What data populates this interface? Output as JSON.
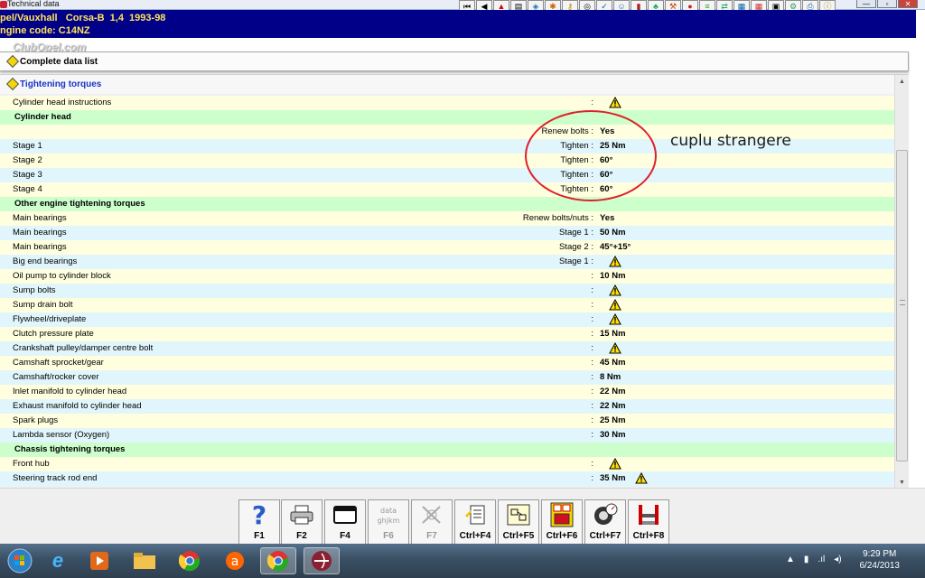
{
  "window": {
    "title": "Technical data"
  },
  "vehicle": {
    "line1": "pel/Vauxhall   Corsa-B  1,4  1993-98",
    "line2": "ngine code: C14NZ"
  },
  "watermark": "ClubOpel.com",
  "nav": {
    "complete_data_label": "Complete data list",
    "section_label": "Tightening torques"
  },
  "rows": [
    {
      "name": "Cylinder head instructions",
      "qualifier": ":",
      "value": "",
      "warn": true,
      "bg": "y"
    },
    {
      "name": "Cylinder head",
      "header": true
    },
    {
      "name": "",
      "qualifier": "Renew bolts :",
      "value": "Yes",
      "bg": "y"
    },
    {
      "name": "Stage 1",
      "qualifier": "Tighten :",
      "value": "25 Nm",
      "bg": "b"
    },
    {
      "name": "Stage 2",
      "qualifier": "Tighten :",
      "value": "60°",
      "bg": "y"
    },
    {
      "name": "Stage 3",
      "qualifier": "Tighten :",
      "value": "60°",
      "bg": "b"
    },
    {
      "name": "Stage 4",
      "qualifier": "Tighten :",
      "value": "60°",
      "bg": "y"
    },
    {
      "name": "Other engine tightening torques",
      "header": true
    },
    {
      "name": "Main bearings",
      "qualifier": "Renew bolts/nuts :",
      "value": "Yes",
      "bg": "y"
    },
    {
      "name": "Main bearings",
      "qualifier": "Stage 1 :",
      "value": "50 Nm",
      "bg": "b"
    },
    {
      "name": "Main bearings",
      "qualifier": "Stage 2 :",
      "value": "45°+15°",
      "bg": "y"
    },
    {
      "name": "Big end bearings",
      "qualifier": "Stage 1 :",
      "value": "",
      "warn": true,
      "bg": "b"
    },
    {
      "name": "Oil pump to cylinder block",
      "qualifier": ":",
      "value": "10 Nm",
      "bg": "y"
    },
    {
      "name": "Sump bolts",
      "qualifier": ":",
      "value": "",
      "warn": true,
      "bg": "b"
    },
    {
      "name": "Sump drain bolt",
      "qualifier": ":",
      "value": "",
      "warn": true,
      "bg": "y"
    },
    {
      "name": "Flywheel/driveplate",
      "qualifier": ":",
      "value": "",
      "warn": true,
      "bg": "b"
    },
    {
      "name": "Clutch pressure plate",
      "qualifier": ":",
      "value": "15 Nm",
      "bg": "y"
    },
    {
      "name": "Crankshaft pulley/damper centre bolt",
      "qualifier": ":",
      "value": "",
      "warn": true,
      "bg": "b"
    },
    {
      "name": "Camshaft sprocket/gear",
      "qualifier": ":",
      "value": "45 Nm",
      "bg": "y"
    },
    {
      "name": "Camshaft/rocker cover",
      "qualifier": ":",
      "value": "8 Nm",
      "bg": "b"
    },
    {
      "name": "Inlet manifold to cylinder head",
      "qualifier": ":",
      "value": "22 Nm",
      "bg": "y"
    },
    {
      "name": "Exhaust manifold to cylinder head",
      "qualifier": ":",
      "value": "22 Nm",
      "bg": "b"
    },
    {
      "name": "Spark plugs",
      "qualifier": ":",
      "value": "25 Nm",
      "bg": "y"
    },
    {
      "name": "Lambda sensor (Oxygen)",
      "qualifier": ":",
      "value": "30 Nm",
      "bg": "b"
    },
    {
      "name": "Chassis tightening torques",
      "header": true
    },
    {
      "name": "Front hub",
      "qualifier": ":",
      "value": "",
      "warn": true,
      "bg": "y"
    },
    {
      "name": "Steering track rod end",
      "qualifier": ":",
      "value": "35 Nm",
      "warn_after": true,
      "bg": "b"
    }
  ],
  "annotation": {
    "text": "cuplu strangere",
    "color": "#e0202a"
  },
  "fkeys": [
    {
      "label": "F1",
      "icon": "help-icon",
      "enabled": true
    },
    {
      "label": "F2",
      "icon": "printer-icon",
      "enabled": true
    },
    {
      "label": "F4",
      "icon": "window-icon",
      "enabled": true
    },
    {
      "label": "F6",
      "icon": "data-icon",
      "enabled": false
    },
    {
      "label": "F7",
      "icon": "tools-icon",
      "enabled": false
    },
    {
      "label": "Ctrl+F4",
      "icon": "notes-icon",
      "enabled": true
    },
    {
      "label": "Ctrl+F5",
      "icon": "diagram-icon",
      "enabled": true
    },
    {
      "label": "Ctrl+F6",
      "icon": "fuse-icon",
      "enabled": true
    },
    {
      "label": "Ctrl+F7",
      "icon": "tyre-icon",
      "enabled": true
    },
    {
      "label": "Ctrl+F8",
      "icon": "lift-icon",
      "enabled": true
    }
  ],
  "taskbar": {
    "time": "9:29 PM",
    "date": "6/24/2013"
  },
  "colors": {
    "header_blue": "#000088",
    "header_text": "#ffe45a",
    "section_link": "#1a33c8",
    "row_yellow": "#ffffe0",
    "row_blue": "#e0f6fc",
    "row_green": "#ccffcc"
  }
}
